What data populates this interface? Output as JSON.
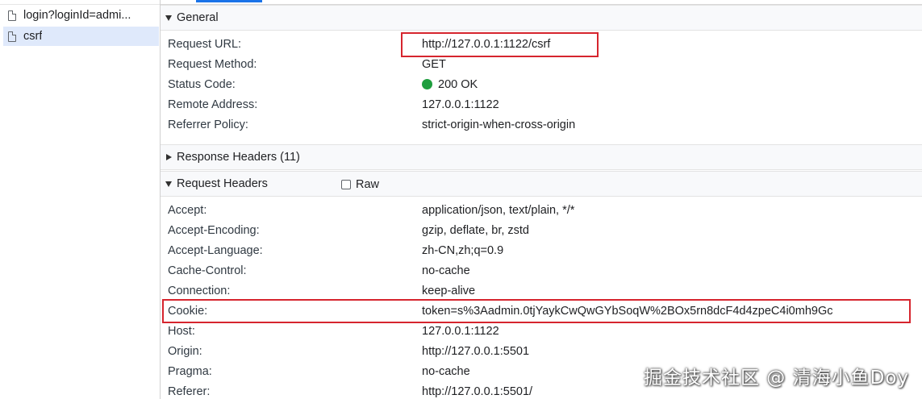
{
  "request_list": {
    "items": [
      {
        "name": "login?loginId=admi...",
        "selected": false
      },
      {
        "name": "csrf",
        "selected": true
      }
    ]
  },
  "general": {
    "title": "General",
    "rows": [
      {
        "key": "Request URL:",
        "value": "http://127.0.0.1:1122/csrf"
      },
      {
        "key": "Request Method:",
        "value": "GET"
      },
      {
        "key": "Status Code:",
        "value": "200 OK"
      },
      {
        "key": "Remote Address:",
        "value": "127.0.0.1:1122"
      },
      {
        "key": "Referrer Policy:",
        "value": "strict-origin-when-cross-origin"
      }
    ]
  },
  "response_headers": {
    "title": "Response Headers (11)"
  },
  "request_headers": {
    "title": "Request Headers",
    "raw_label": "Raw",
    "raw_checked": false,
    "rows": [
      {
        "key": "Accept:",
        "value": "application/json, text/plain, */*"
      },
      {
        "key": "Accept-Encoding:",
        "value": "gzip, deflate, br, zstd"
      },
      {
        "key": "Accept-Language:",
        "value": "zh-CN,zh;q=0.9"
      },
      {
        "key": "Cache-Control:",
        "value": "no-cache"
      },
      {
        "key": "Connection:",
        "value": "keep-alive"
      },
      {
        "key": "Cookie:",
        "value": "token=s%3Aadmin.0tjYaykCwQwGYbSoqW%2BOx5rn8dcF4d4zpeC4i0mh9Gc"
      },
      {
        "key": "Host:",
        "value": "127.0.0.1:1122"
      },
      {
        "key": "Origin:",
        "value": "http://127.0.0.1:5501"
      },
      {
        "key": "Pragma:",
        "value": "no-cache"
      },
      {
        "key": "Referer:",
        "value": "http://127.0.0.1:5501/"
      }
    ]
  },
  "watermark": "掘金技术社区 @ 清海小鱼Doy",
  "colors": {
    "status_ok": "#1e9e3e",
    "highlight": "#d6252e",
    "selected_row": "#dfe9fb"
  }
}
